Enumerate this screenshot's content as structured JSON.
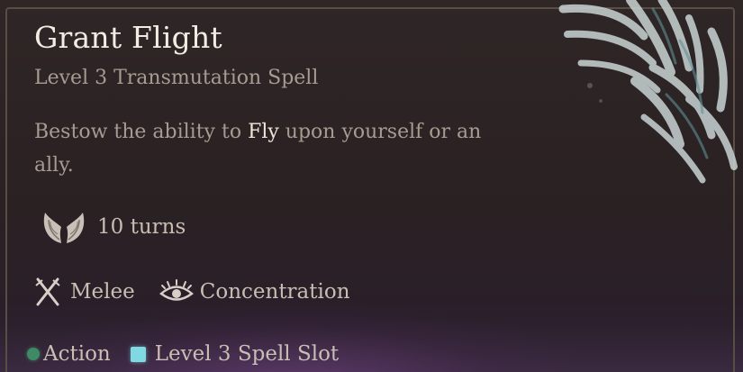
{
  "spell": {
    "name": "Grant Flight",
    "subtitle": "Level 3 Transmutation Spell",
    "description": {
      "before": "Bestow the ability to ",
      "keyword": "Fly",
      "after": " upon yourself or an ally."
    },
    "duration": {
      "icon": "wings-icon",
      "label": "10 turns"
    },
    "properties": [
      {
        "icon": "crossed-swords-icon",
        "label": "Melee"
      },
      {
        "icon": "eye-concentration-icon",
        "label": "Concentration"
      }
    ],
    "costs": [
      {
        "icon": "action-dot-icon",
        "label": "Action",
        "color": "#3d8a64"
      },
      {
        "icon": "spell-slot-icon",
        "label": "Level 3 Spell Slot",
        "color": "#7fd8e2"
      }
    ]
  },
  "colors": {
    "title": "#f1ece4",
    "subtitle": "#a79c91",
    "keyword": "#eee6d8",
    "background": "#2a2123"
  },
  "decoration": {
    "icon": "feather-wing-art-icon"
  }
}
